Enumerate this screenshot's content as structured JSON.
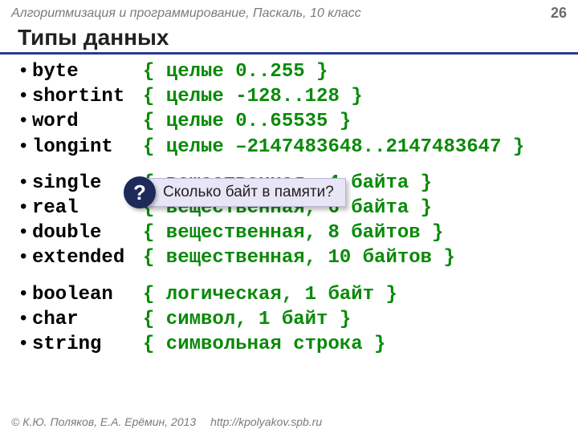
{
  "header": {
    "course": "Алгоритмизация и программирование, Паскаль, 10 класс",
    "page": "26"
  },
  "title": "Типы данных",
  "groups": [
    [
      {
        "type": "byte",
        "comment": "{ целые 0..255 }"
      },
      {
        "type": "shortint",
        "comment": "{ целые -128..128 }"
      },
      {
        "type": "word",
        "comment": "{ целые 0..65535 }"
      },
      {
        "type": "longint",
        "comment": "{ целые –2147483648..2147483647 }"
      }
    ],
    [
      {
        "type": "single",
        "comment": "{ вещественная, 4 байта }"
      },
      {
        "type": "real",
        "comment": "{ вещественная, 6 байта }"
      },
      {
        "type": "double",
        "comment": "{ вещественная, 8 байтов }"
      },
      {
        "type": "extended",
        "comment": "{ вещественная, 10 байтов }"
      }
    ],
    [
      {
        "type": "boolean",
        "comment": "{ логическая, 1 байт }"
      },
      {
        "type": "char",
        "comment": "{ символ, 1 байт }"
      },
      {
        "type": "string",
        "comment": "{ символьная строка }"
      }
    ]
  ],
  "callout": {
    "mark": "?",
    "text": "Сколько байт в памяти?"
  },
  "footer": {
    "copyright": "© К.Ю. Поляков, Е.А. Ерёмин, 2013",
    "link": "http://kpolyakov.spb.ru"
  }
}
